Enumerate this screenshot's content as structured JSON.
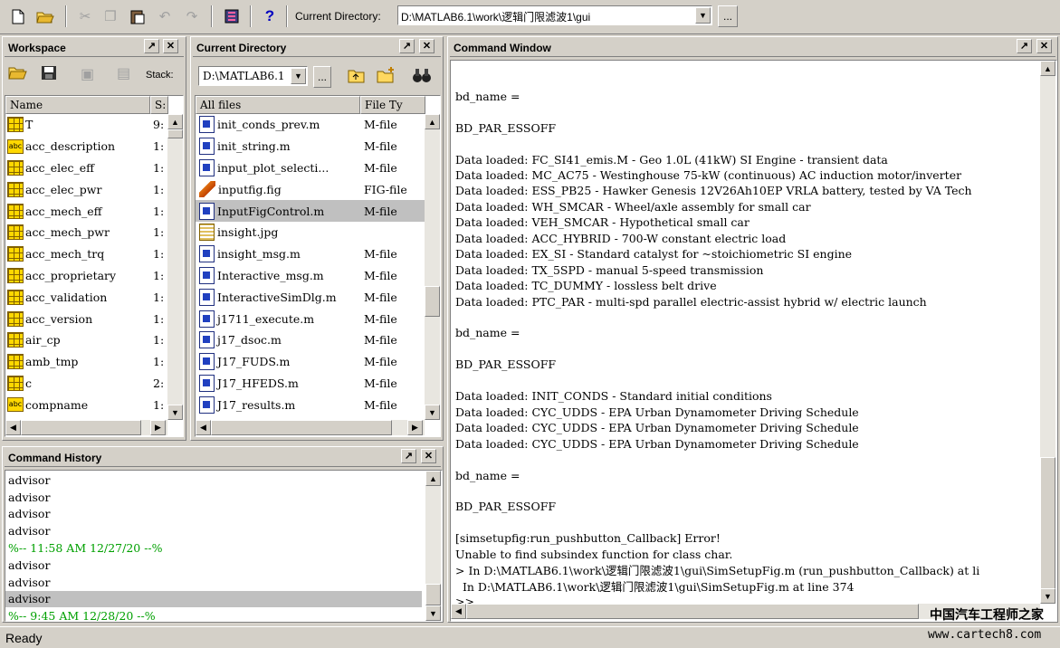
{
  "toolbar": {
    "current_directory_label": "Current Directory:",
    "current_directory_value": "D:\\MATLAB6.1\\work\\逻辑门限滤波1\\gui",
    "browse_label": "...",
    "help_label": "?"
  },
  "workspace": {
    "title": "Workspace",
    "stack_label": "Stack:",
    "columns": [
      "Name",
      "S:"
    ],
    "rows": [
      {
        "name": "T",
        "size": "9:",
        "icon": "matrix-icon"
      },
      {
        "name": "acc_description",
        "size": "1:",
        "icon": "char-icon"
      },
      {
        "name": "acc_elec_eff",
        "size": "1:",
        "icon": "matrix-icon"
      },
      {
        "name": "acc_elec_pwr",
        "size": "1:",
        "icon": "matrix-icon"
      },
      {
        "name": "acc_mech_eff",
        "size": "1:",
        "icon": "matrix-icon"
      },
      {
        "name": "acc_mech_pwr",
        "size": "1:",
        "icon": "matrix-icon"
      },
      {
        "name": "acc_mech_trq",
        "size": "1:",
        "icon": "matrix-icon"
      },
      {
        "name": "acc_proprietary",
        "size": "1:",
        "icon": "matrix-icon"
      },
      {
        "name": "acc_validation",
        "size": "1:",
        "icon": "matrix-icon"
      },
      {
        "name": "acc_version",
        "size": "1:",
        "icon": "matrix-icon"
      },
      {
        "name": "air_cp",
        "size": "1:",
        "icon": "matrix-icon"
      },
      {
        "name": "amb_tmp",
        "size": "1:",
        "icon": "matrix-icon"
      },
      {
        "name": "c",
        "size": "2:",
        "icon": "matrix-icon"
      },
      {
        "name": "compname",
        "size": "1:",
        "icon": "char-icon"
      }
    ]
  },
  "current_directory": {
    "title": "Current Directory",
    "path_value": "D:\\MATLAB6.1",
    "browse_label": "...",
    "columns": [
      "All files",
      "File Ty"
    ],
    "rows": [
      {
        "name": "init_conds_prev.m",
        "type": "M-file",
        "icon": "m-file-icon",
        "selected": false
      },
      {
        "name": "init_string.m",
        "type": "M-file",
        "icon": "m-file-icon",
        "selected": false
      },
      {
        "name": "input_plot_selecti...",
        "type": "M-file",
        "icon": "m-file-icon",
        "selected": false
      },
      {
        "name": "inputfig.fig",
        "type": "FIG-file",
        "icon": "fig-file-icon",
        "selected": false
      },
      {
        "name": "InputFigControl.m",
        "type": "M-file",
        "icon": "m-file-icon",
        "selected": true
      },
      {
        "name": "insight.jpg",
        "type": "",
        "icon": "jpg-file-icon",
        "selected": false
      },
      {
        "name": "insight_msg.m",
        "type": "M-file",
        "icon": "m-file-icon",
        "selected": false
      },
      {
        "name": "Interactive_msg.m",
        "type": "M-file",
        "icon": "m-file-icon",
        "selected": false
      },
      {
        "name": "InteractiveSimDlg.m",
        "type": "M-file",
        "icon": "m-file-icon",
        "selected": false
      },
      {
        "name": "j1711_execute.m",
        "type": "M-file",
        "icon": "m-file-icon",
        "selected": false
      },
      {
        "name": "j17_dsoc.m",
        "type": "M-file",
        "icon": "m-file-icon",
        "selected": false
      },
      {
        "name": "J17_FUDS.m",
        "type": "M-file",
        "icon": "m-file-icon",
        "selected": false
      },
      {
        "name": "J17_HFEDS.m",
        "type": "M-file",
        "icon": "m-file-icon",
        "selected": false
      },
      {
        "name": "J17_results.m",
        "type": "M-file",
        "icon": "m-file-icon",
        "selected": false
      }
    ]
  },
  "command_history": {
    "title": "Command History",
    "lines": [
      {
        "text": "advisor",
        "kind": "cmd",
        "selected": false
      },
      {
        "text": "advisor",
        "kind": "cmd",
        "selected": false
      },
      {
        "text": "advisor",
        "kind": "cmd",
        "selected": false
      },
      {
        "text": "advisor",
        "kind": "cmd",
        "selected": false
      },
      {
        "text": "%-- 11:58 AM 12/27/20 --%",
        "kind": "session",
        "selected": false
      },
      {
        "text": "advisor",
        "kind": "cmd",
        "selected": false
      },
      {
        "text": "advisor",
        "kind": "cmd",
        "selected": false
      },
      {
        "text": "advisor",
        "kind": "cmd",
        "selected": true
      },
      {
        "text": "%-- 9:45 AM 12/28/20 --%",
        "kind": "session",
        "selected": false
      }
    ]
  },
  "command_window": {
    "title": "Command Window",
    "lines": [
      "",
      "bd_name =",
      "",
      "BD_PAR_ESSOFF",
      "",
      "Data loaded: FC_SI41_emis.M - Geo 1.0L (41kW) SI Engine - transient data",
      "Data loaded: MC_AC75 - Westinghouse 75-kW (continuous) AC induction motor/inverter",
      "Data loaded: ESS_PB25 - Hawker Genesis 12V26Ah10EP VRLA battery, tested by VA Tech",
      "Data loaded: WH_SMCAR - Wheel/axle assembly for small car",
      "Data loaded: VEH_SMCAR - Hypothetical small car",
      "Data loaded: ACC_HYBRID - 700-W constant electric load",
      "Data loaded: EX_SI - Standard catalyst for ~stoichiometric SI engine",
      "Data loaded: TX_5SPD - manual 5-speed transmission",
      "Data loaded: TC_DUMMY - lossless belt drive",
      "Data loaded: PTC_PAR - multi-spd parallel electric-assist hybrid w/ electric launch",
      "",
      "bd_name =",
      "",
      "BD_PAR_ESSOFF",
      "",
      "Data loaded: INIT_CONDS - Standard initial conditions",
      "Data loaded: CYC_UDDS - EPA Urban Dynamometer Driving Schedule",
      "Data loaded: CYC_UDDS - EPA Urban Dynamometer Driving Schedule",
      "Data loaded: CYC_UDDS - EPA Urban Dynamometer Driving Schedule",
      "",
      "bd_name =",
      "",
      "BD_PAR_ESSOFF",
      "",
      "[simsetupfig:run_pushbutton_Callback] Error!",
      "Unable to find subsindex function for class char.",
      "> In D:\\MATLAB6.1\\work\\逻辑门限滤波1\\gui\\SimSetupFig.m (run_pushbutton_Callback) at li",
      "  In D:\\MATLAB6.1\\work\\逻辑门限滤波1\\gui\\SimSetupFig.m at line 374",
      ">>"
    ]
  },
  "status": {
    "text": "Ready"
  },
  "watermark": {
    "line1": "中国汽车工程师之家",
    "line2": "www.cartech8.com"
  },
  "colors": {
    "session_green": "#00a000",
    "selection": "#c0c0c0",
    "face": "#d4d0c8"
  }
}
